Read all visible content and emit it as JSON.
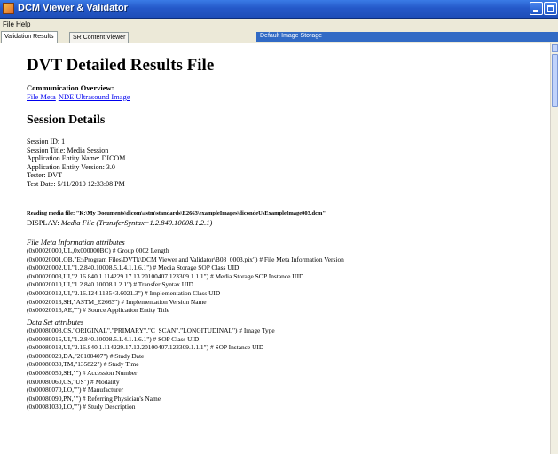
{
  "window": {
    "title": "DCM Viewer & Validator"
  },
  "menu": {
    "items": [
      "File",
      "Help"
    ]
  },
  "tabs": {
    "items": [
      "Validation Results",
      "SR Content Viewer"
    ],
    "active": "Validation Results",
    "storage_label": "Default Image Storage"
  },
  "report": {
    "title": "DVT Detailed Results File",
    "communication_label": "Communication Overview:",
    "links": [
      "File Meta",
      "NDE Ultrasound Image"
    ],
    "session_heading": "Session Details",
    "session": [
      "Session ID: 1",
      "Session Title: Media Session",
      "Application Entity Name: DICOM",
      "Application Entity Version: 3.0",
      "Tester: DVT",
      "Test Date: 5/11/2010 12:33:08 PM"
    ],
    "reading_file": "Reading media file: \"K:\\My Documents\\dicom\\astm\\standards\\E2663\\exampleImages\\dicondeUsExampleImage003.dcm\"",
    "display_prefix": "DISPLAY:",
    "display_value": "Media File (TransferSyntax=1.2.840.10008.1.2.1)",
    "file_meta_heading": "File Meta Information attributes",
    "file_meta": [
      "(0x00020000,UL,0x000000BC) # Group 0002 Length",
      "(0x00020001,OB,\"E:\\Program Files\\DVTk\\DCM Viewer and Validator\\B08_0003.pix\") # File Meta Information Version",
      "(0x00020002,UI,\"1.2.840.10008.5.1.4.1.1.6.1\") # Media Storage SOP Class UID",
      "(0x00020003,UI,\"2.16.840.1.114229.17.13.20100407.123309.1.1.1\") # Media Storage SOP Instance UID",
      "(0x00020010,UI,\"1.2.840.10008.1.2.1\") # Transfer Syntax UID",
      "(0x00020012,UI,\"2.16.124.113543.6021.3\") # Implementation Class UID",
      "(0x00020013,SH,\"ASTM_E2663\") # Implementation Version Name",
      "(0x00020016,AE,\"\") # Source Application Entity Title"
    ],
    "dataset_heading": "Data Set attributes",
    "dataset": [
      "(0x00080008,CS,\"ORIGINAL\",\"PRIMARY\",\"C_SCAN\",\"LONGITUDINAL\") # Image Type",
      "(0x00080016,UI,\"1.2.840.10008.5.1.4.1.1.6.1\") # SOP Class UID",
      "(0x00080018,UI,\"2.16.840.1.114229.17.13.20100407.123309.1.1.1\") # SOP Instance UID",
      "(0x00080020,DA,\"20100407\") # Study Date",
      "(0x00080030,TM,\"135822\") # Study Time",
      "(0x00080050,SH,\"\") # Accession Number",
      "(0x00080060,CS,\"US\") # Modality",
      "(0x00080070,LO,\"\") # Manufacturer",
      "(0x00080090,PN,\"\") # Referring Physician's Name",
      "(0x00081030,LO,\"\") # Study Description"
    ]
  }
}
